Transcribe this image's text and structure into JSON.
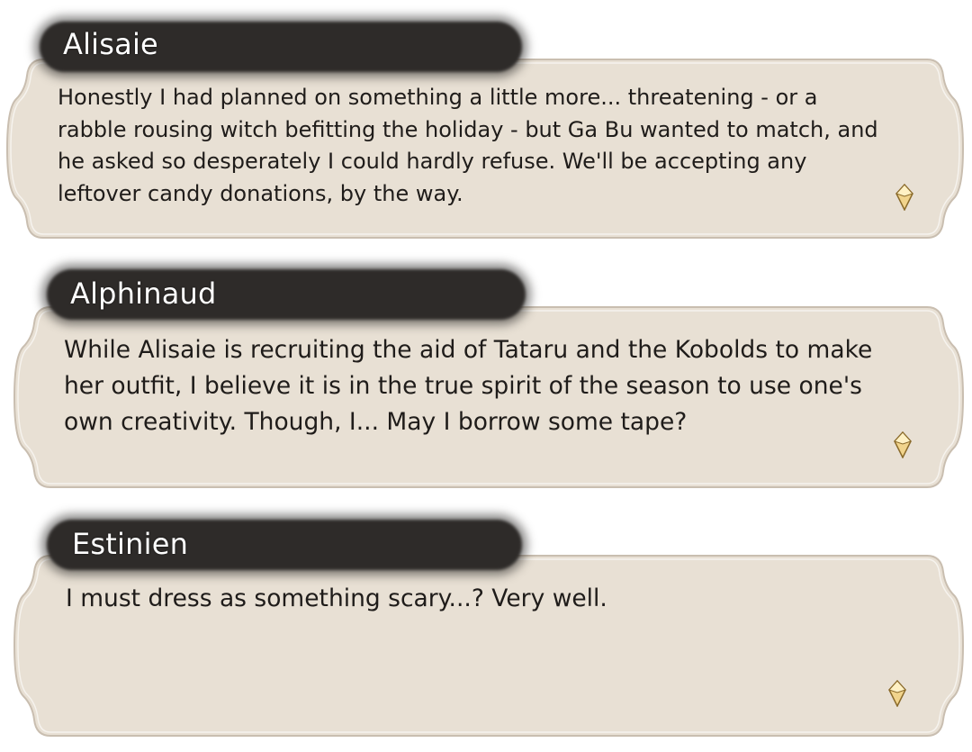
{
  "colors": {
    "panel_fill": "#e8e0d4",
    "panel_border": "#c9beb0",
    "nameplate": "#2e2b29",
    "speaker_text": "#ffffff",
    "dialogue_text": "#1f1c1a",
    "advance_icon": "#d9b26a"
  },
  "dialogues": [
    {
      "speaker": "Alisaie",
      "text": "Honestly I had planned on something a little more... threatening - or a rabble rousing witch befitting the holiday - but Ga Bu wanted to match, and he asked so desperately I could hardly refuse. We'll be accepting any leftover candy donations, by the way.",
      "advance_icon": "diamond-advance-icon"
    },
    {
      "speaker": "Alphinaud",
      "text": "While Alisaie is recruiting the aid of Tataru and the Kobolds to make her outfit, I believe it is in the true spirit of the season to use one's own creativity. Though, I... May I borrow some tape?",
      "advance_icon": "diamond-advance-icon"
    },
    {
      "speaker": "Estinien",
      "text": "I must dress as something scary...? Very well.",
      "advance_icon": "diamond-advance-icon"
    }
  ]
}
